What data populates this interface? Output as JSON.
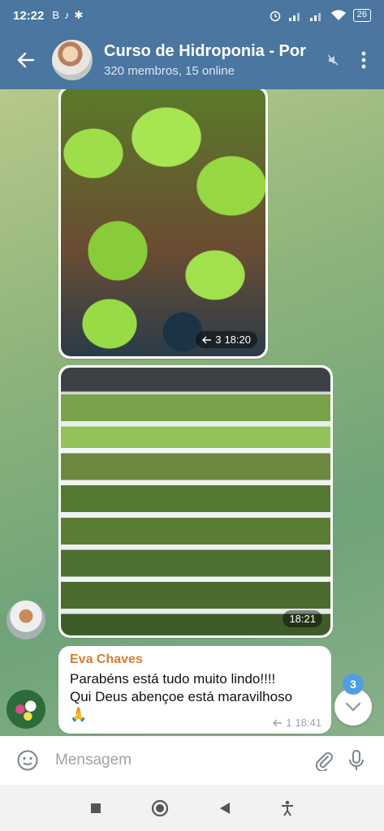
{
  "status_bar": {
    "time": "12:22",
    "left_icons": [
      "B",
      "♪",
      "✱"
    ],
    "battery": "26"
  },
  "header": {
    "title": "Curso de Hidroponia - Por",
    "subtitle": "320 membros, 15 online"
  },
  "messages": [
    {
      "type": "photo",
      "forwards": "3",
      "time": "18:20"
    },
    {
      "type": "photo",
      "time": "18:21"
    },
    {
      "type": "text",
      "sender": "Eva Chaves",
      "line1": "Parabéns está tudo muito lindo!!!!",
      "line2": "Qui Deus abençoe está maravilhoso",
      "emoji": "🙏",
      "forwards": "1",
      "time": "18:41"
    }
  ],
  "unread_count": "3",
  "input": {
    "placeholder": "Mensagem"
  },
  "colors": {
    "header": "#4a76a0",
    "sender_name": "#d97c2c",
    "badge": "#4d9fe0"
  }
}
